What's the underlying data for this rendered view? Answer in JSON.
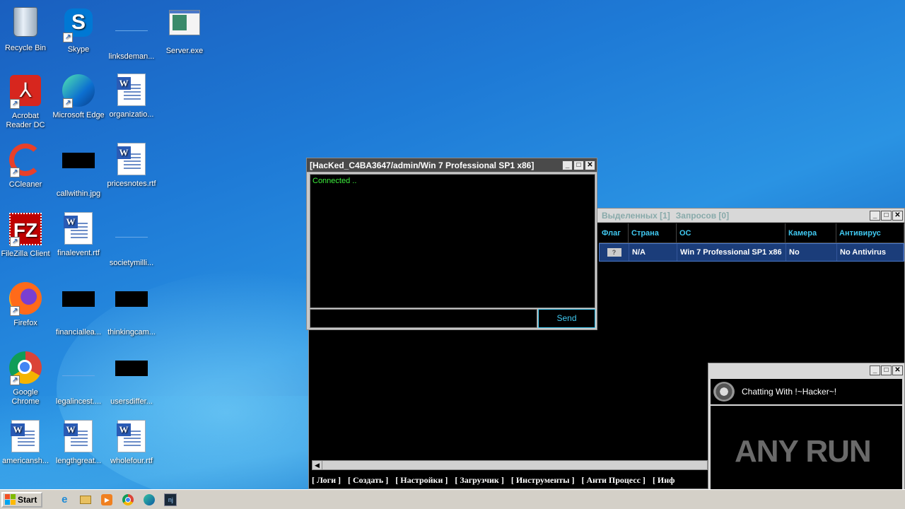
{
  "desktop": {
    "icons": [
      {
        "label": "Recycle Bin",
        "icon": "recycle-bin-icon"
      },
      {
        "label": "Skype",
        "icon": "skype-icon"
      },
      {
        "label": "linksdeman...",
        "icon": "blank-file-icon"
      },
      {
        "label": "Server.exe",
        "icon": "exe-icon"
      },
      {
        "label": "Acrobat Reader DC",
        "icon": "acrobat-icon"
      },
      {
        "label": "Microsoft Edge",
        "icon": "edge-icon"
      },
      {
        "label": "organizatio...",
        "icon": "word-doc-icon"
      },
      {
        "label": "CCleaner",
        "icon": "ccleaner-icon"
      },
      {
        "label": "callwithin.jpg",
        "icon": "black-thumbnail-icon"
      },
      {
        "label": "pricesnotes.rtf",
        "icon": "word-doc-icon"
      },
      {
        "label": "FileZilla Client",
        "icon": "filezilla-icon"
      },
      {
        "label": "finalevent.rtf",
        "icon": "word-doc-icon"
      },
      {
        "label": "societymilli...",
        "icon": "blank-file-icon"
      },
      {
        "label": "Firefox",
        "icon": "firefox-icon"
      },
      {
        "label": "financiallea...",
        "icon": "black-thumbnail-icon"
      },
      {
        "label": "thinkingcam...",
        "icon": "black-thumbnail-icon"
      },
      {
        "label": "Google Chrome",
        "icon": "chrome-icon"
      },
      {
        "label": "legalincest....",
        "icon": "blank-file-icon"
      },
      {
        "label": "usersdiffer...",
        "icon": "black-thumbnail-icon"
      },
      {
        "label": "americansh...",
        "icon": "word-doc-icon"
      },
      {
        "label": "lengthgreat...",
        "icon": "word-doc-icon"
      },
      {
        "label": "wholefour.rtf",
        "icon": "word-doc-icon"
      }
    ]
  },
  "chat_window": {
    "title": "[HacKed_C4BA3647/admin/Win 7 Professional SP1 x86]",
    "log": "Connected ..",
    "input_value": "",
    "send_label": "Send"
  },
  "main_window": {
    "status_selected": "Выделенных [1]",
    "status_requests": "Запросов [0]",
    "columns": [
      "Флаг",
      "Страна",
      "ОС",
      "Камера",
      "Антивирус"
    ],
    "row": {
      "flag": "?",
      "country": "N/A",
      "os": "Win 7 Professional SP1 x86",
      "camera": "No",
      "antivirus": "No Antivirus"
    },
    "menu": [
      "[ Логи ]",
      "[ Создать ]",
      "[ Настройки ]",
      "[ Загрузчик ]",
      "[ Инструменты ]",
      "[ Анти Процесс ]",
      "[ Инф"
    ]
  },
  "hacker_chat": {
    "title": "Chatting With !~Hacker~!",
    "watermark": "ANY RUN"
  },
  "taskbar": {
    "start_label": "Start",
    "apps": [
      "ie-icon",
      "explorer-icon",
      "media-player-icon",
      "chrome-icon",
      "edge-icon",
      "njrat-icon"
    ]
  },
  "colors": {
    "accent": "#40c8f0",
    "connected": "#3cf03c",
    "selected_row": "#1b3d7a"
  }
}
